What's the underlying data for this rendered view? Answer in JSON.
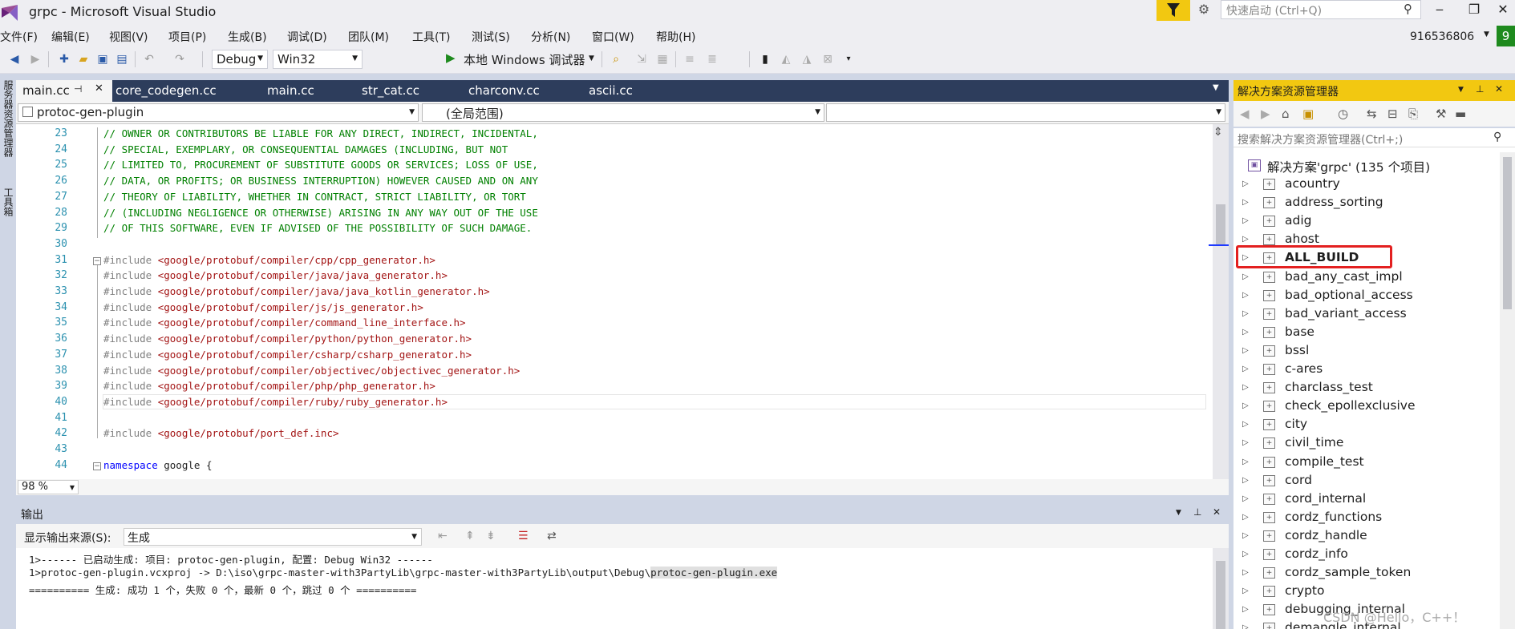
{
  "window": {
    "title": "grpc - Microsoft Visual Studio",
    "quick_launch_placeholder": "快速启动 (Ctrl+Q)",
    "minimize": "‒",
    "maximize": "❐",
    "close": "✕"
  },
  "menu": {
    "items": [
      "文件(F)",
      "编辑(E)",
      "视图(V)",
      "项目(P)",
      "生成(B)",
      "调试(D)",
      "团队(M)",
      "工具(T)",
      "测试(S)",
      "分析(N)",
      "窗口(W)",
      "帮助(H)"
    ],
    "account": "916536806",
    "account_badge": "9"
  },
  "toolbar": {
    "config": "Debug",
    "platform": "Win32",
    "run_label": "本地 Windows 调试器"
  },
  "left_strip": {
    "server_explorer": "服务器资源管理器",
    "toolbox": "工具箱"
  },
  "editor": {
    "tabs": [
      "main.cc",
      "core_codegen.cc",
      "main.cc",
      "str_cat.cc",
      "charconv.cc",
      "ascii.cc"
    ],
    "project_combo": "protoc-gen-plugin",
    "scope_combo": "(全局范围)",
    "member_combo": "",
    "zoom": "98 %",
    "lines": [
      {
        "n": "23",
        "segs": [
          {
            "t": "// OWNER OR CONTRIBUTORS BE LIABLE FOR ANY DIRECT, INDIRECT, INCIDENTAL,",
            "c": "comment"
          }
        ]
      },
      {
        "n": "24",
        "segs": [
          {
            "t": "// SPECIAL, EXEMPLARY, OR CONSEQUENTIAL DAMAGES (INCLUDING, BUT NOT",
            "c": "comment"
          }
        ]
      },
      {
        "n": "25",
        "segs": [
          {
            "t": "// LIMITED TO, PROCUREMENT OF SUBSTITUTE GOODS OR SERVICES; LOSS OF USE,",
            "c": "comment"
          }
        ]
      },
      {
        "n": "26",
        "segs": [
          {
            "t": "// DATA, OR PROFITS; OR BUSINESS INTERRUPTION) HOWEVER CAUSED AND ON ANY",
            "c": "comment"
          }
        ]
      },
      {
        "n": "27",
        "segs": [
          {
            "t": "// THEORY OF LIABILITY, WHETHER IN CONTRACT, STRICT LIABILITY, OR TORT",
            "c": "comment"
          }
        ]
      },
      {
        "n": "28",
        "segs": [
          {
            "t": "// (INCLUDING NEGLIGENCE OR OTHERWISE) ARISING IN ANY WAY OUT OF THE USE",
            "c": "comment"
          }
        ]
      },
      {
        "n": "29",
        "segs": [
          {
            "t": "// OF THIS SOFTWARE, EVEN IF ADVISED OF THE POSSIBILITY OF SUCH DAMAGE.",
            "c": "comment"
          }
        ]
      },
      {
        "n": "30",
        "segs": []
      },
      {
        "n": "31",
        "segs": [
          {
            "t": "#include ",
            "c": "pp"
          },
          {
            "t": "<google/protobuf/compiler/cpp/cpp_generator.h>",
            "c": "str"
          }
        ]
      },
      {
        "n": "32",
        "segs": [
          {
            "t": "#include ",
            "c": "pp"
          },
          {
            "t": "<google/protobuf/compiler/java/java_generator.h>",
            "c": "str"
          }
        ]
      },
      {
        "n": "33",
        "segs": [
          {
            "t": "#include ",
            "c": "pp"
          },
          {
            "t": "<google/protobuf/compiler/java/java_kotlin_generator.h>",
            "c": "str"
          }
        ]
      },
      {
        "n": "34",
        "segs": [
          {
            "t": "#include ",
            "c": "pp"
          },
          {
            "t": "<google/protobuf/compiler/js/js_generator.h>",
            "c": "str"
          }
        ]
      },
      {
        "n": "35",
        "segs": [
          {
            "t": "#include ",
            "c": "pp"
          },
          {
            "t": "<google/protobuf/compiler/command_line_interface.h>",
            "c": "str"
          }
        ]
      },
      {
        "n": "36",
        "segs": [
          {
            "t": "#include ",
            "c": "pp"
          },
          {
            "t": "<google/protobuf/compiler/python/python_generator.h>",
            "c": "str"
          }
        ]
      },
      {
        "n": "37",
        "segs": [
          {
            "t": "#include ",
            "c": "pp"
          },
          {
            "t": "<google/protobuf/compiler/csharp/csharp_generator.h>",
            "c": "str"
          }
        ]
      },
      {
        "n": "38",
        "segs": [
          {
            "t": "#include ",
            "c": "pp"
          },
          {
            "t": "<google/protobuf/compiler/objectivec/objectivec_generator.h>",
            "c": "str"
          }
        ]
      },
      {
        "n": "39",
        "segs": [
          {
            "t": "#include ",
            "c": "pp"
          },
          {
            "t": "<google/protobuf/compiler/php/php_generator.h>",
            "c": "str"
          }
        ]
      },
      {
        "n": "40",
        "segs": [
          {
            "t": "#include ",
            "c": "pp"
          },
          {
            "t": "<google/protobuf/compiler/ruby/ruby_generator.h>",
            "c": "str"
          }
        ]
      },
      {
        "n": "41",
        "segs": []
      },
      {
        "n": "42",
        "segs": [
          {
            "t": "#include ",
            "c": "pp"
          },
          {
            "t": "<google/protobuf/port_def.inc>",
            "c": "str"
          }
        ]
      },
      {
        "n": "43",
        "segs": []
      },
      {
        "n": "44",
        "segs": [
          {
            "t": "namespace",
            "c": "kw"
          },
          {
            "t": " google {",
            "c": "plain"
          }
        ]
      }
    ]
  },
  "output": {
    "title": "输出",
    "source_label": "显示输出来源(S):",
    "source_value": "生成",
    "line1": "1>------ 已启动生成: 项目: protoc-gen-plugin, 配置: Debug Win32 ------",
    "line2_prefix": "1>protoc-gen-plugin.vcxproj -> D:\\iso\\grpc-master-with3PartyLib\\grpc-master-with3PartyLib\\output\\Debug\\",
    "line2_highlight": "protoc-gen-plugin.exe",
    "line3": "========== 生成: 成功 1 个，失败 0 个，最新 0 个，跳过 0 个 =========="
  },
  "solution_explorer": {
    "title": "解决方案资源管理器",
    "search_placeholder": "搜索解决方案资源管理器(Ctrl+;)",
    "solution_label": "解决方案'grpc' (135 个项目)",
    "projects": [
      "acountry",
      "address_sorting",
      "adig",
      "ahost",
      "ALL_BUILD",
      "bad_any_cast_impl",
      "bad_optional_access",
      "bad_variant_access",
      "base",
      "bssl",
      "c-ares",
      "charclass_test",
      "check_epollexclusive",
      "city",
      "civil_time",
      "compile_test",
      "cord",
      "cord_internal",
      "cordz_functions",
      "cordz_handle",
      "cordz_info",
      "cordz_sample_token",
      "crypto",
      "debugging_internal",
      "demangle_internal"
    ],
    "highlighted_project": "ALL_BUILD"
  },
  "watermark": "CSDN @Hello，C++！"
}
